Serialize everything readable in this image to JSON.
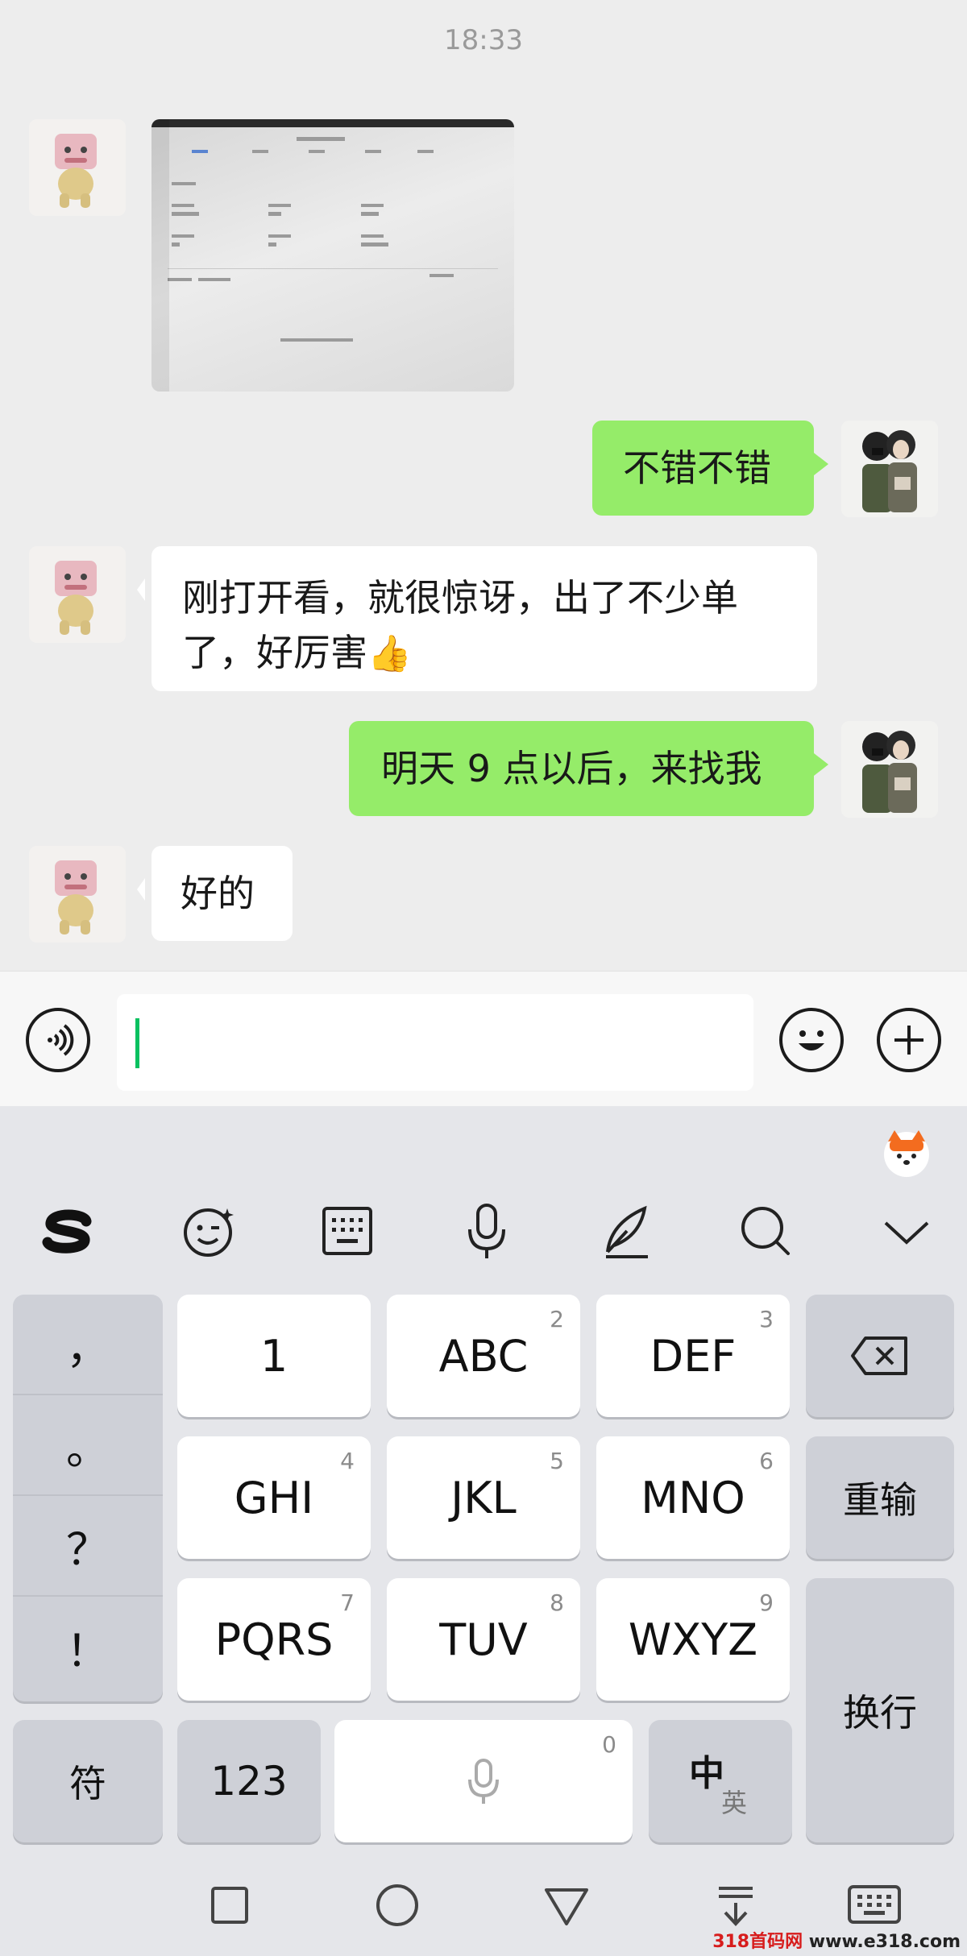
{
  "chat": {
    "timestamp": "18:33",
    "messages": [
      {
        "side": "in",
        "type": "image",
        "description_icon": "screenshot-photo"
      },
      {
        "side": "out",
        "text": "不错不错"
      },
      {
        "side": "in",
        "text": "刚打开看，就很惊讶，出了不少单了，好厉害",
        "emoji": "👍"
      },
      {
        "side": "out",
        "text": "明天 9 点以后，来找我"
      },
      {
        "side": "in",
        "text": "好的"
      }
    ]
  },
  "input": {
    "voice_icon": "voice-icon",
    "emoji_icon": "emoji-icon",
    "plus_icon": "plus-icon",
    "value": ""
  },
  "keyboard": {
    "toolbar": [
      "sogou-logo",
      "emoji-wink-icon",
      "keyboard-icon",
      "mic-icon",
      "handwrite-icon",
      "search-icon",
      "chevron-down-icon"
    ],
    "punct": [
      "，",
      "。",
      "？",
      "！"
    ],
    "keys": [
      {
        "label": "1",
        "num": ""
      },
      {
        "label": "ABC",
        "num": "2"
      },
      {
        "label": "DEF",
        "num": "3"
      },
      {
        "label": "GHI",
        "num": "4"
      },
      {
        "label": "JKL",
        "num": "5"
      },
      {
        "label": "MNO",
        "num": "6"
      },
      {
        "label": "PQRS",
        "num": "7"
      },
      {
        "label": "TUV",
        "num": "8"
      },
      {
        "label": "WXYZ",
        "num": "9"
      }
    ],
    "reinput": "重输",
    "enter": "换行",
    "symbol": "符",
    "numeric": "123",
    "space_num": "0",
    "lang_zh": "中",
    "lang_en": "英"
  },
  "watermark": {
    "brand": "318首码网",
    "url": "www.e318.com"
  },
  "colors": {
    "bubble_out": "#95ec69",
    "caret": "#07c160",
    "background": "#ededed"
  }
}
